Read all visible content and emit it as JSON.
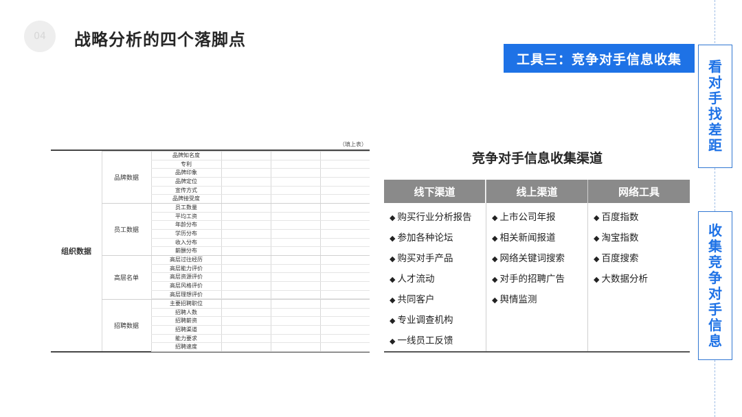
{
  "header": {
    "page_number": "04",
    "title": "战略分析的四个落脚点",
    "tool_banner": "工具三：竞争对手信息收集"
  },
  "side_labels": {
    "top": [
      "看",
      "对",
      "手",
      "找",
      "差",
      "距"
    ],
    "bottom": [
      "收",
      "集",
      "竞",
      "争",
      "对",
      "手",
      "信",
      "息"
    ]
  },
  "org_table": {
    "note": "（填上表）",
    "root_label": "组织数据",
    "groups": [
      {
        "label": "品牌数据",
        "items": [
          "品牌知名度",
          "专利",
          "品牌印象",
          "品牌定位",
          "宣传方式",
          "品牌接受度"
        ]
      },
      {
        "label": "员工数据",
        "items": [
          "员工数量",
          "平均工资",
          "年龄分布",
          "学历分布",
          "收入分布",
          "薪酬分布"
        ]
      },
      {
        "label": "高层名单",
        "items": [
          "高层过往经历",
          "高层能力评价",
          "高层资源评价",
          "高层风格评价",
          "高层理想评价"
        ]
      },
      {
        "label": "招聘数据",
        "items": [
          "主要招聘职位",
          "招聘人数",
          "招聘薪资",
          "招聘渠道",
          "能力要求",
          "招聘速度"
        ]
      }
    ]
  },
  "channels": {
    "title": "竞争对手信息收集渠道",
    "columns": [
      {
        "header": "线下渠道",
        "items": [
          "购买行业分析报告",
          "参加各种论坛",
          "购买对手产品",
          "人才流动",
          "共同客户",
          "专业调查机构",
          "一线员工反馈"
        ]
      },
      {
        "header": "线上渠道",
        "items": [
          "上市公司年报",
          "相关新闻报道",
          "网络关键词搜索",
          "对手的招聘广告",
          "舆情监测"
        ]
      },
      {
        "header": "网络工具",
        "items": [
          "百度指数",
          "淘宝指数",
          "百度搜索",
          "大数据分析"
        ]
      }
    ]
  },
  "colors": {
    "accent_blue": "#1e72e6",
    "header_gray": "#8a8a8a"
  }
}
